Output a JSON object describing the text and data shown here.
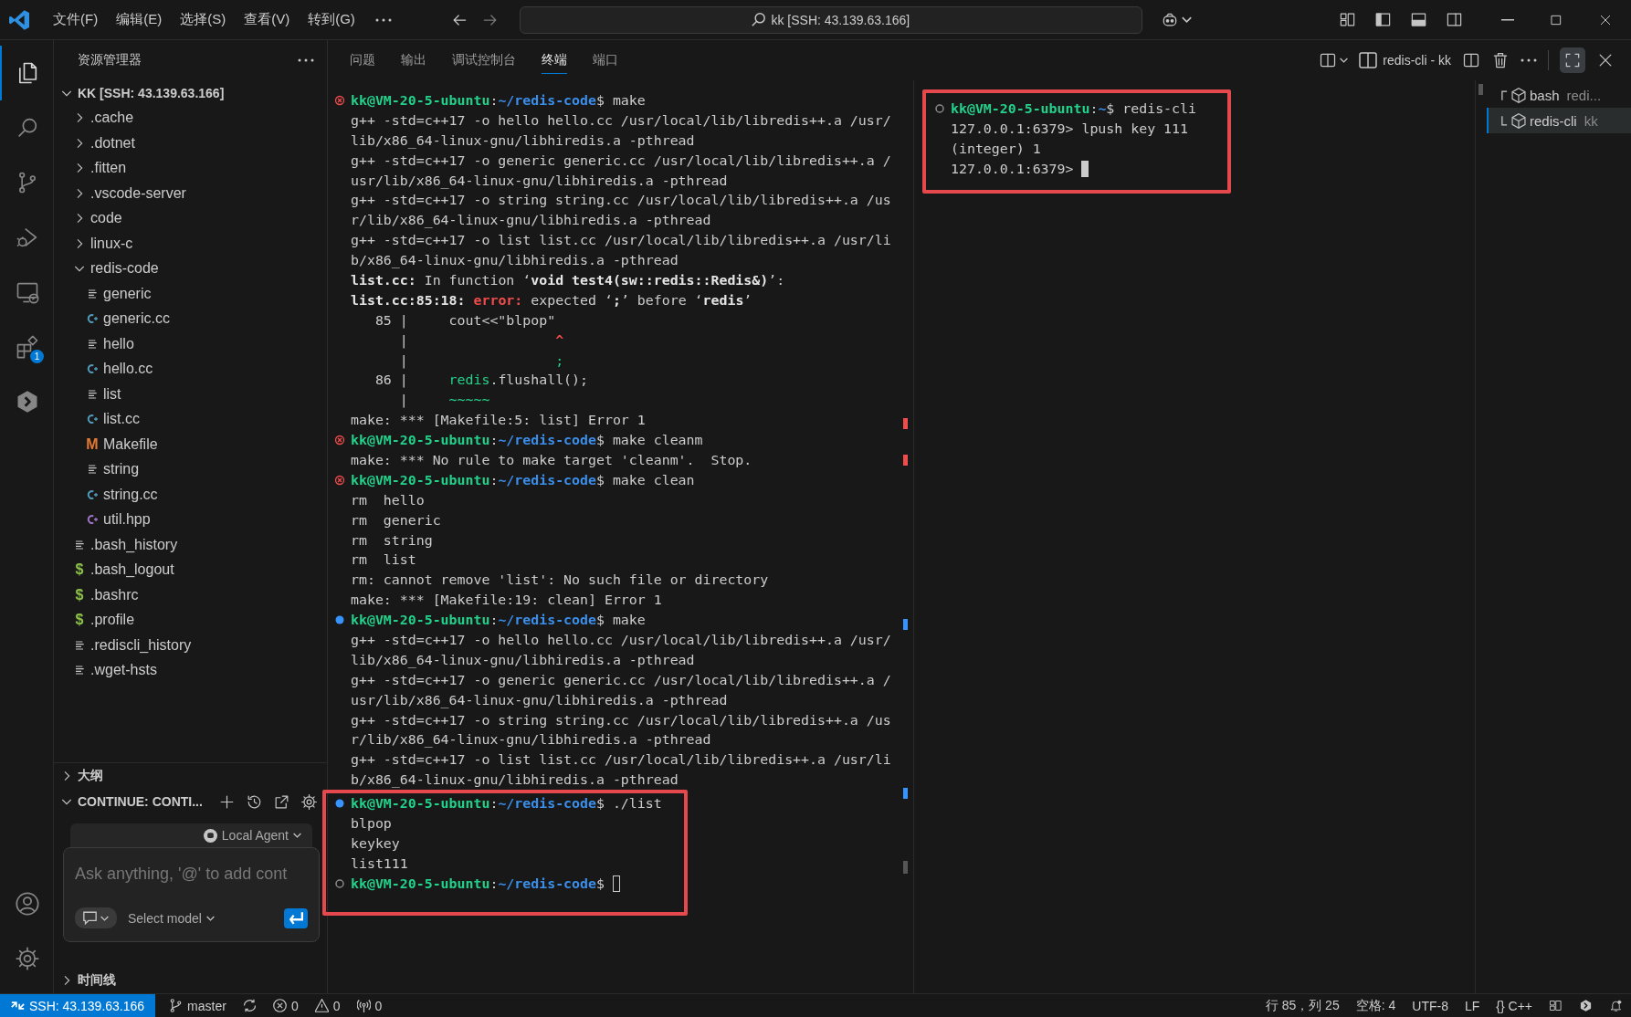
{
  "title_bar": {
    "menus": [
      "文件(F)",
      "编辑(E)",
      "选择(S)",
      "查看(V)",
      "转到(G)"
    ],
    "command_center": "kk [SSH: 43.139.63.166]"
  },
  "activity_bar": {
    "items": [
      {
        "kind": "explorer",
        "selected": true
      },
      {
        "kind": "search",
        "selected": false
      },
      {
        "kind": "source_control",
        "selected": false
      },
      {
        "kind": "run_debug",
        "selected": false
      },
      {
        "kind": "remote",
        "selected": false
      },
      {
        "kind": "extensions",
        "selected": false,
        "badge": "1"
      },
      {
        "kind": "continue",
        "selected": false
      }
    ],
    "bottom": [
      {
        "kind": "account"
      },
      {
        "kind": "settings"
      }
    ]
  },
  "explorer": {
    "title": "资源管理器",
    "root": {
      "label": "KK [SSH: 43.139.63.166]",
      "kind": "folder",
      "expanded": true,
      "children": [
        {
          "label": ".cache",
          "kind": "folder",
          "expanded": false
        },
        {
          "label": ".dotnet",
          "kind": "folder",
          "expanded": false
        },
        {
          "label": ".fitten",
          "kind": "folder",
          "expanded": false
        },
        {
          "label": ".vscode-server",
          "kind": "folder",
          "expanded": false
        },
        {
          "label": "code",
          "kind": "folder",
          "expanded": false
        },
        {
          "label": "linux-c",
          "kind": "folder",
          "expanded": false
        },
        {
          "label": "redis-code",
          "kind": "folder",
          "expanded": true,
          "children": [
            {
              "label": "generic",
              "kind": "text"
            },
            {
              "label": "generic.cc",
              "kind": "cpp"
            },
            {
              "label": "hello",
              "kind": "text"
            },
            {
              "label": "hello.cc",
              "kind": "cpp"
            },
            {
              "label": "list",
              "kind": "text"
            },
            {
              "label": "list.cc",
              "kind": "cpp"
            },
            {
              "label": "Makefile",
              "kind": "glyph",
              "glyph": "M",
              "color": "#e37933"
            },
            {
              "label": "string",
              "kind": "text"
            },
            {
              "label": "string.cc",
              "kind": "cpp"
            },
            {
              "label": "util.hpp",
              "kind": "hpp"
            }
          ]
        },
        {
          "label": ".bash_history",
          "kind": "text"
        },
        {
          "label": ".bash_logout",
          "kind": "glyph",
          "glyph": "$",
          "color": "#8dc149"
        },
        {
          "label": ".bashrc",
          "kind": "glyph",
          "glyph": "$",
          "color": "#8dc149"
        },
        {
          "label": ".profile",
          "kind": "glyph",
          "glyph": "$",
          "color": "#8dc149"
        },
        {
          "label": ".rediscli_history",
          "kind": "text"
        },
        {
          "label": ".wget-hsts",
          "kind": "text"
        }
      ]
    }
  },
  "outline": {
    "title": "大纲",
    "expanded": false
  },
  "continue_panel": {
    "title": "CONTINUE: CONTI...",
    "expanded": true,
    "agent": "Local Agent",
    "placeholder": "Ask anything, '@' to add cont",
    "model": "Select model"
  },
  "timeline": {
    "title": "时间线",
    "expanded": false
  },
  "panel": {
    "tabs": [
      {
        "label": "问题",
        "selected": false
      },
      {
        "label": "输出",
        "selected": false
      },
      {
        "label": "调试控制台",
        "selected": false
      },
      {
        "label": "终端",
        "selected": true
      },
      {
        "label": "端口",
        "selected": false
      }
    ],
    "active_terminal": "redis-cli - kk",
    "maximized": true,
    "terminals": [
      {
        "focused": false,
        "blocks": [
          {
            "highlighted": false,
            "lines": [
              {
                "kind": "error",
                "segments": [
                  {
                    "text": "kk@VM-20-5-ubuntu",
                    "kind": "user"
                  },
                  {
                    "text": ":",
                    "kind": "plain"
                  },
                  {
                    "text": "~/redis-code",
                    "kind": "path"
                  },
                  {
                    "text": "$ make",
                    "kind": "plain"
                  }
                ]
              },
              {
                "kind": "output",
                "segments": [
                  {
                    "text": "g++ -std=c++17 -o hello hello.cc /usr/local/lib/libredis++.a /usr/",
                    "kind": "plain"
                  }
                ]
              },
              {
                "kind": "output",
                "segments": [
                  {
                    "text": "lib/x86_64-linux-gnu/libhiredis.a -pthread",
                    "kind": "plain"
                  }
                ]
              },
              {
                "kind": "output",
                "segments": [
                  {
                    "text": "g++ -std=c++17 -o generic generic.cc /usr/local/lib/libredis++.a /",
                    "kind": "plain"
                  }
                ]
              },
              {
                "kind": "output",
                "segments": [
                  {
                    "text": "usr/lib/x86_64-linux-gnu/libhiredis.a -pthread",
                    "kind": "plain"
                  }
                ]
              },
              {
                "kind": "output",
                "segments": [
                  {
                    "text": "g++ -std=c++17 -o string string.cc /usr/local/lib/libredis++.a /us",
                    "kind": "plain"
                  }
                ]
              },
              {
                "kind": "output",
                "segments": [
                  {
                    "text": "r/lib/x86_64-linux-gnu/libhiredis.a -pthread",
                    "kind": "plain"
                  }
                ]
              },
              {
                "kind": "output",
                "segments": [
                  {
                    "text": "g++ -std=c++17 -o list list.cc /usr/local/lib/libredis++.a /usr/li",
                    "kind": "plain"
                  }
                ]
              },
              {
                "kind": "output",
                "segments": [
                  {
                    "text": "b/x86_64-linux-gnu/libhiredis.a -pthread",
                    "kind": "plain"
                  }
                ]
              },
              {
                "kind": "output",
                "segments": [
                  {
                    "text": "list.cc:",
                    "kind": "bold"
                  },
                  {
                    "text": " In function ‘",
                    "kind": "plain"
                  },
                  {
                    "text": "void test4(sw::redis::Redis&)",
                    "kind": "bold"
                  },
                  {
                    "text": "’:",
                    "kind": "plain"
                  }
                ]
              },
              {
                "kind": "output",
                "segments": [
                  {
                    "text": "list.cc:85:18: ",
                    "kind": "bold"
                  },
                  {
                    "text": "error:",
                    "kind": "error"
                  },
                  {
                    "text": " expected ‘",
                    "kind": "plain"
                  },
                  {
                    "text": ";",
                    "kind": "bold"
                  },
                  {
                    "text": "’ before ‘",
                    "kind": "plain"
                  },
                  {
                    "text": "redis",
                    "kind": "bold"
                  },
                  {
                    "text": "’",
                    "kind": "plain"
                  }
                ]
              },
              {
                "kind": "output",
                "segments": [
                  {
                    "text": "   85 |     cout<<\"blpop\"",
                    "kind": "plain"
                  }
                ]
              },
              {
                "kind": "output",
                "segments": [
                  {
                    "text": "      |                  ",
                    "kind": "plain"
                  },
                  {
                    "text": "^",
                    "kind": "caret"
                  }
                ]
              },
              {
                "kind": "output",
                "segments": [
                  {
                    "text": "      |                  ",
                    "kind": "plain"
                  },
                  {
                    "text": ";",
                    "kind": "code"
                  }
                ]
              },
              {
                "kind": "output",
                "segments": [
                  {
                    "text": "   86 |     ",
                    "kind": "plain"
                  },
                  {
                    "text": "redis",
                    "kind": "code"
                  },
                  {
                    "text": ".flushall();",
                    "kind": "plain"
                  }
                ]
              },
              {
                "kind": "output",
                "segments": [
                  {
                    "text": "      |     ",
                    "kind": "plain"
                  },
                  {
                    "text": "~~~~~",
                    "kind": "code"
                  }
                ]
              },
              {
                "kind": "output",
                "segments": [
                  {
                    "text": "make: *** [Makefile:5: list] Error 1",
                    "kind": "plain"
                  }
                ]
              },
              {
                "kind": "error",
                "segments": [
                  {
                    "text": "kk@VM-20-5-ubuntu",
                    "kind": "user"
                  },
                  {
                    "text": ":",
                    "kind": "plain"
                  },
                  {
                    "text": "~/redis-code",
                    "kind": "path"
                  },
                  {
                    "text": "$ make cleanm",
                    "kind": "plain"
                  }
                ]
              },
              {
                "kind": "output",
                "segments": [
                  {
                    "text": "make: *** No rule to make target 'cleanm'.  Stop.",
                    "kind": "plain"
                  }
                ]
              },
              {
                "kind": "error",
                "segments": [
                  {
                    "text": "kk@VM-20-5-ubuntu",
                    "kind": "user"
                  },
                  {
                    "text": ":",
                    "kind": "plain"
                  },
                  {
                    "text": "~/redis-code",
                    "kind": "path"
                  },
                  {
                    "text": "$ make clean",
                    "kind": "plain"
                  }
                ]
              },
              {
                "kind": "output",
                "segments": [
                  {
                    "text": "rm  hello",
                    "kind": "plain"
                  }
                ]
              },
              {
                "kind": "output",
                "segments": [
                  {
                    "text": "rm  generic",
                    "kind": "plain"
                  }
                ]
              },
              {
                "kind": "output",
                "segments": [
                  {
                    "text": "rm  string",
                    "kind": "plain"
                  }
                ]
              },
              {
                "kind": "output",
                "segments": [
                  {
                    "text": "rm  list",
                    "kind": "plain"
                  }
                ]
              },
              {
                "kind": "output",
                "segments": [
                  {
                    "text": "rm: cannot remove 'list': No such file or directory",
                    "kind": "plain"
                  }
                ]
              },
              {
                "kind": "output",
                "segments": [
                  {
                    "text": "make: *** [Makefile:19: clean] Error 1",
                    "kind": "plain"
                  }
                ]
              },
              {
                "kind": "success",
                "segments": [
                  {
                    "text": "kk@VM-20-5-ubuntu",
                    "kind": "user"
                  },
                  {
                    "text": ":",
                    "kind": "plain"
                  },
                  {
                    "text": "~/redis-code",
                    "kind": "path"
                  },
                  {
                    "text": "$ make",
                    "kind": "plain"
                  }
                ]
              },
              {
                "kind": "output",
                "segments": [
                  {
                    "text": "g++ -std=c++17 -o hello hello.cc /usr/local/lib/libredis++.a /usr/",
                    "kind": "plain"
                  }
                ]
              },
              {
                "kind": "output",
                "segments": [
                  {
                    "text": "lib/x86_64-linux-gnu/libhiredis.a -pthread",
                    "kind": "plain"
                  }
                ]
              },
              {
                "kind": "output",
                "segments": [
                  {
                    "text": "g++ -std=c++17 -o generic generic.cc /usr/local/lib/libredis++.a /",
                    "kind": "plain"
                  }
                ]
              },
              {
                "kind": "output",
                "segments": [
                  {
                    "text": "usr/lib/x86_64-linux-gnu/libhiredis.a -pthread",
                    "kind": "plain"
                  }
                ]
              },
              {
                "kind": "output",
                "segments": [
                  {
                    "text": "g++ -std=c++17 -o string string.cc /usr/local/lib/libredis++.a /us",
                    "kind": "plain"
                  }
                ]
              },
              {
                "kind": "output",
                "segments": [
                  {
                    "text": "r/lib/x86_64-linux-gnu/libhiredis.a -pthread",
                    "kind": "plain"
                  }
                ]
              },
              {
                "kind": "output",
                "segments": [
                  {
                    "text": "g++ -std=c++17 -o list list.cc /usr/local/lib/libredis++.a /usr/li",
                    "kind": "plain"
                  }
                ]
              },
              {
                "kind": "output",
                "segments": [
                  {
                    "text": "b/x86_64-linux-gnu/libhiredis.a -pthread",
                    "kind": "plain"
                  }
                ]
              }
            ]
          },
          {
            "highlighted": true,
            "lines": [
              {
                "kind": "success",
                "segments": [
                  {
                    "text": "kk@VM-20-5-ubuntu",
                    "kind": "user"
                  },
                  {
                    "text": ":",
                    "kind": "plain"
                  },
                  {
                    "text": "~/redis-code",
                    "kind": "path"
                  },
                  {
                    "text": "$ ./list",
                    "kind": "plain"
                  }
                ]
              },
              {
                "kind": "output",
                "segments": [
                  {
                    "text": "blpop",
                    "kind": "plain"
                  }
                ]
              },
              {
                "kind": "output",
                "segments": [
                  {
                    "text": "keykey",
                    "kind": "plain"
                  }
                ]
              },
              {
                "kind": "output",
                "segments": [
                  {
                    "text": "list111",
                    "kind": "plain"
                  }
                ]
              },
              {
                "kind": "idle",
                "cursor": true,
                "segments": [
                  {
                    "text": "kk@VM-20-5-ubuntu",
                    "kind": "user"
                  },
                  {
                    "text": ":",
                    "kind": "plain"
                  },
                  {
                    "text": "~/redis-code",
                    "kind": "path"
                  },
                  {
                    "text": "$",
                    "kind": "plain"
                  }
                ]
              }
            ]
          }
        ]
      },
      {
        "focused": true,
        "blocks": [
          {
            "highlighted": true,
            "lines": [
              {
                "kind": "idle",
                "segments": [
                  {
                    "text": "kk@VM-20-5-ubuntu",
                    "kind": "user"
                  },
                  {
                    "text": ":",
                    "kind": "plain"
                  },
                  {
                    "text": "~",
                    "kind": "path"
                  },
                  {
                    "text": "$ redis-cli",
                    "kind": "plain"
                  }
                ]
              },
              {
                "kind": "output",
                "segments": [
                  {
                    "text": "127.0.0.1:6379> lpush key 111",
                    "kind": "plain"
                  }
                ]
              },
              {
                "kind": "output",
                "segments": [
                  {
                    "text": "(integer) 1",
                    "kind": "plain"
                  }
                ]
              },
              {
                "kind": "output",
                "cursor": true,
                "segments": [
                  {
                    "text": "127.0.0.1:6379>",
                    "kind": "plain"
                  }
                ]
              }
            ]
          }
        ]
      }
    ],
    "terminal_tabs": [
      {
        "name": "bash",
        "detail": "redi...",
        "selected": false
      },
      {
        "name": "redis-cli",
        "detail": "kk",
        "selected": true
      }
    ]
  },
  "status_bar": {
    "left": [
      {
        "kind": "remote",
        "text": "SSH: 43.139.63.166"
      },
      {
        "kind": "branch",
        "text": "master"
      },
      {
        "kind": "sync"
      },
      {
        "kind": "errors",
        "text": "0"
      },
      {
        "kind": "warnings",
        "text": "0"
      },
      {
        "kind": "ports",
        "text": "0"
      }
    ],
    "right": [
      {
        "kind": "plain",
        "text": "行 85，列 25"
      },
      {
        "kind": "plain",
        "text": "空格: 4"
      },
      {
        "kind": "plain",
        "text": "UTF-8"
      },
      {
        "kind": "plain",
        "text": "LF"
      },
      {
        "kind": "plain",
        "text": "{} C++"
      },
      {
        "kind": "layout"
      },
      {
        "kind": "continue"
      },
      {
        "kind": "bell"
      }
    ]
  }
}
